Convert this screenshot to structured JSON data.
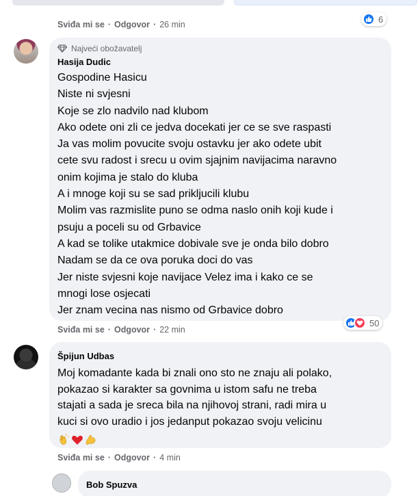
{
  "prev_comment": {
    "like_label": "Sviđa mi se",
    "reply_label": "Odgovor",
    "time": "26 min",
    "reaction_count": "6"
  },
  "comment1": {
    "badge": "Najveći obožavatelj",
    "author": "Hasija Dudic",
    "lines": [
      "Gospodine Hasicu",
      "Niste ni svjesni",
      "Koje se zlo nadvilo nad klubom",
      "Ako odete oni zli ce jedva docekati jer ce se sve raspasti",
      "Ja vas molim povucite svoju ostavku jer ako odete ubit",
      "cete svu radost i srecu u ovim sjajnim navijacima naravno",
      "onim kojima je stalo do kluba",
      "A i mnoge koji su se sad prikljucili klubu",
      "Molim vas razmislite puno se odma naslo onih koji kude i",
      "psuju a poceli su od Grbavice",
      "A kad se tolike utakmice dobivale sve je onda bilo dobro",
      "Nadam se da ce ova poruka doci do vas",
      "Jer niste svjesni koje navijace Velez ima i kako ce se",
      "mnogi lose osjecati",
      "Jer znam vecina nas nismo od Grbavice dobro"
    ],
    "like_label": "Sviđa mi se",
    "reply_label": "Odgovor",
    "time": "22 min",
    "reaction_count": "50"
  },
  "comment2": {
    "author": "Špijun Udbas",
    "lines": [
      "Moj komadante kada bi znali ono sto ne znaju ali polako,",
      "pokazao si karakter sa govnima u istom safu ne treba",
      "stajati a sada je sreca bila na njihovoj strani, radi mira u",
      "kuci si ovo uradio i jos jedanput pokazao svoju velicinu"
    ],
    "emojis": [
      "clapping-hands-emoji",
      "red-heart-emoji",
      "flexed-biceps-emoji"
    ],
    "like_label": "Sviđa mi se",
    "reply_label": "Odgovor",
    "time": "4 min"
  },
  "comment3": {
    "author": "Bob Spuzva"
  },
  "colors": {
    "like_blue": "#1877f2",
    "love_red": "#f33e58",
    "bubble_bg": "#f0f2f5",
    "meta_gray": "#65676b"
  }
}
